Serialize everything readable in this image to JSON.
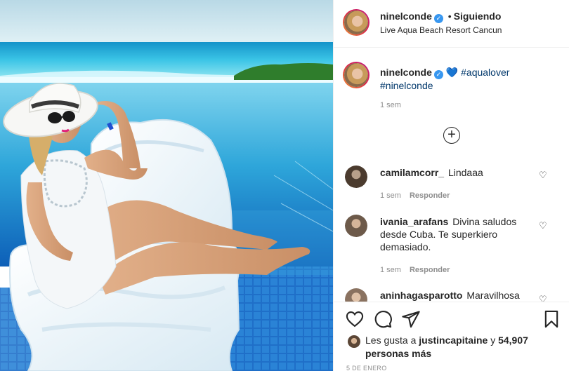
{
  "post": {
    "photo_alt": "",
    "header": {
      "username": "ninelconde",
      "verified_icon": "verified-badge-icon",
      "separator": "•",
      "follow_state": "Siguiendo",
      "location": "Live Aqua Beach Resort Cancun"
    },
    "caption": {
      "username": "ninelconde",
      "emoji": "💙",
      "hashtags": [
        "#aqualover",
        "#ninelconde"
      ],
      "time": "1 sem"
    },
    "load_more_icon": "plus-circle-icon",
    "comments": [
      {
        "username": "camilamcorr_",
        "text": "Lindaaa",
        "time": "1 sem",
        "reply": "Responder"
      },
      {
        "username": "ivania_arafans",
        "text": "Divina saludos desde Cuba. Te superkiero demasiado.",
        "time": "1 sem",
        "reply": "Responder"
      },
      {
        "username": "aninhagasparotto",
        "text": "Maravilhosa",
        "time": "",
        "reply": ""
      }
    ],
    "likes": {
      "prefix": "Les gusta a",
      "user": "justincapitaine",
      "conjunction": "y",
      "count": "54,907 personas más"
    },
    "date": "5 DE ENERO",
    "colors": {
      "text": "#262626",
      "muted": "#8e8e8e",
      "link": "#00376b",
      "verified": "#3897f0",
      "border": "#efefef"
    }
  }
}
